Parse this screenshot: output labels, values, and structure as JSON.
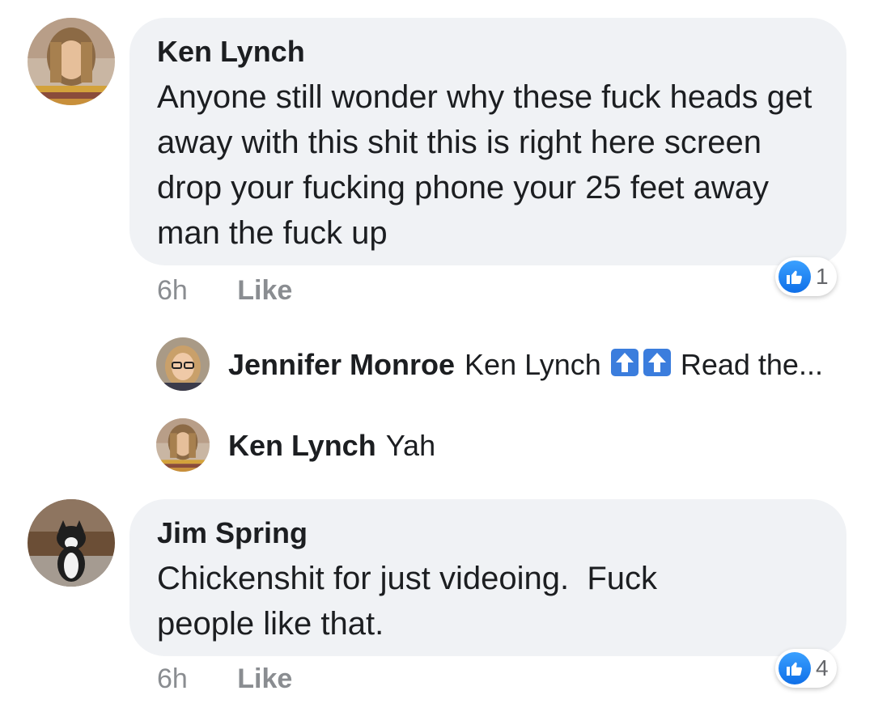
{
  "comments": [
    {
      "author": "Ken Lynch",
      "text": "Anyone still wonder why these fuck heads get away with this shit this is right here screen drop your fucking phone your 25 feet away man the fuck up",
      "time": "6h",
      "like_label": "Like",
      "reaction_count": "1",
      "avatar_icon": "person-avatar-icon"
    },
    {
      "author": "Jim Spring",
      "text": "Chickenshit for just videoing.  Fuck people like that.",
      "time": "6h",
      "like_label": "Like",
      "reaction_count": "4",
      "avatar_icon": "cat-avatar-icon"
    }
  ],
  "replies": [
    {
      "author": "Jennifer Monroe",
      "mention": "Ken Lynch",
      "trail": "Read the...",
      "emoji": [
        "up-arrow-icon",
        "up-arrow-icon"
      ]
    },
    {
      "author": "Ken Lynch",
      "text": "Yah"
    }
  ],
  "colors": {
    "bubble": "#f0f2f5",
    "meta_gray": "#8a8d91",
    "like_blue": "#1877f2",
    "arrow_blue": "#3b7ddd"
  }
}
